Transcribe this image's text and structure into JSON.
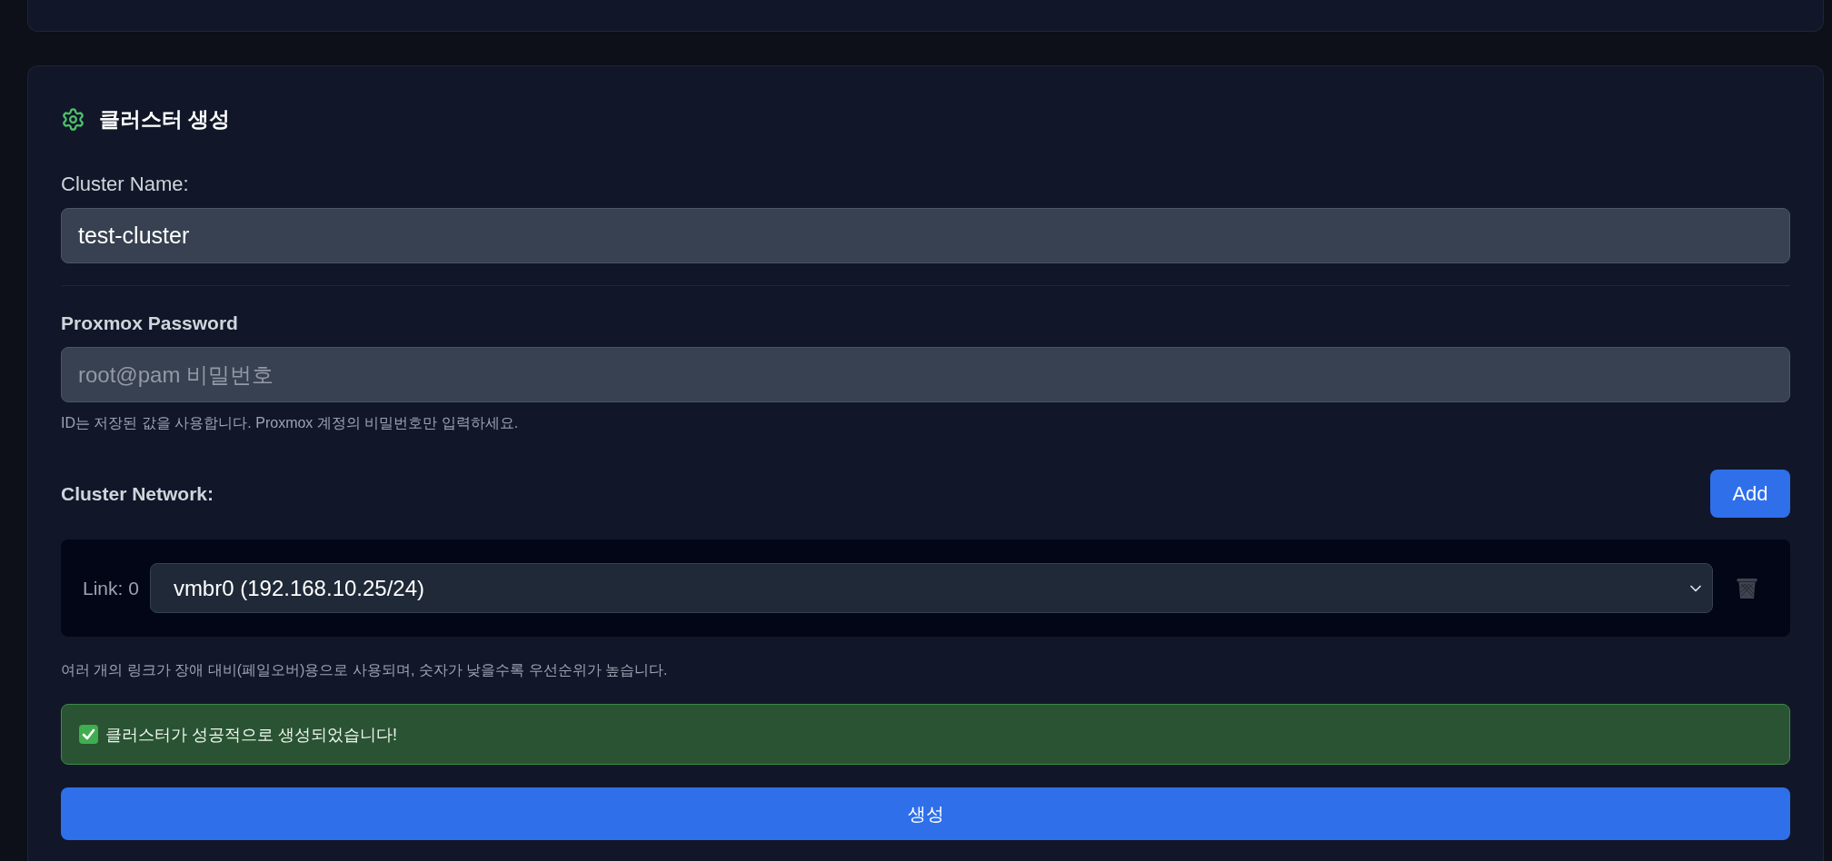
{
  "cluster_form": {
    "title": "클러스터 생성",
    "cluster_name": {
      "label": "Cluster Name:",
      "value": "test-cluster"
    },
    "password": {
      "label": "Proxmox Password",
      "placeholder": "root@pam 비밀번호",
      "hint": "ID는 저장된 값을 사용합니다. Proxmox 계정의 비밀번호만 입력하세요."
    },
    "network": {
      "label": "Cluster Network:",
      "add_button": "Add",
      "links": [
        {
          "label": "Link: 0",
          "value": "vmbr0 (192.168.10.25/24)",
          "remove_disabled": true
        }
      ],
      "hint": "여러 개의 링크가 장애 대비(페일오버)용으로 사용되며, 숫자가 낮을수록 우선순위가 높습니다."
    },
    "alert": {
      "kind": "success",
      "message": "클러스터가 성공적으로 생성되었습니다!"
    },
    "submit_button": "생성"
  }
}
